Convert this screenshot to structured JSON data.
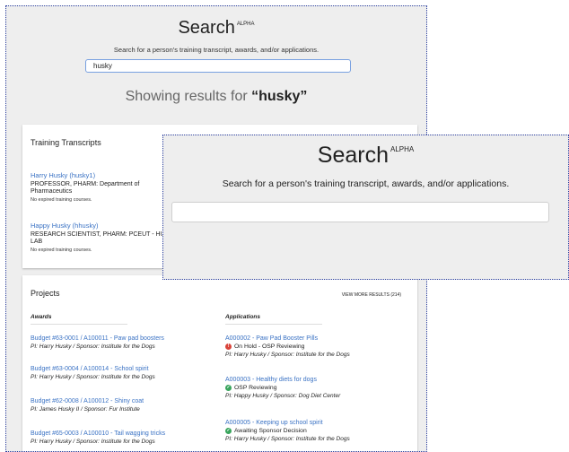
{
  "search": {
    "title": "Search",
    "badge": "ALPHA",
    "subtitle": "Search for a person's training transcript, awards, and/or applications.",
    "query": "husky",
    "showing_prefix": "Showing results for ",
    "showing_query": "“husky”"
  },
  "overlay": {
    "title": "Search",
    "badge": "ALPHA",
    "subtitle": "Search for a person's training transcript, awards, and/or applications.",
    "query": ""
  },
  "training": {
    "title": "Training Transcripts",
    "entries": [
      {
        "name": "Harry Husky (husky1)",
        "role": "PROFESSOR, PHARM: Department of Pharmaceutics",
        "note": "No expired training courses."
      },
      {
        "name": "Happy Husky (hhusky)",
        "role": "RESEARCH SCIENTIST, PHARM: PCEUT - HU LAB",
        "note": "No expired training courses."
      }
    ]
  },
  "projects": {
    "title": "Projects",
    "view_more": "VIEW MORE RESULTS (214)",
    "awards_header": "Awards",
    "applications_header": "Applications",
    "awards": [
      {
        "link": "Budget #63-0001 / A100011 - Paw pad boosters",
        "pi": "PI: Harry Husky / Sponsor: Institute for the Dogs"
      },
      {
        "link": "Budget #63-0004 / A100014 - School spirit",
        "pi": "PI: Harry Husky / Sponsor: Institute for the Dogs"
      },
      {
        "link": "Budget #62-0008 / A100012 - Shiny coat",
        "pi": "PI: James Husky II / Sponsor: Fur Institute"
      },
      {
        "link": "Budget #65-0003 / A100010 - Tail wagging tricks",
        "pi": "PI: Harry Husky / Sponsor: Institute for the Dogs"
      }
    ],
    "applications": [
      {
        "link": "A000002 - Paw Pad Booster Pills",
        "status": "On Hold - OSP Reviewing",
        "status_icon": "alert-icon",
        "status_color": "#d9443a",
        "pi": "PI: Harry Husky / Sponsor: Institute for the Dogs"
      },
      {
        "link": "A000003 - Healthy diets for dogs",
        "status": "OSP Reviewing",
        "status_icon": "check-icon",
        "status_color": "#3aa55d",
        "pi": "PI: Happy Husky / Sponsor: Dog Diet Center"
      },
      {
        "link": "A000005 - Keeping up school spirit",
        "status": "Awaiting Sponsor Decision",
        "status_icon": "check-icon",
        "status_color": "#3aa55d",
        "pi": "PI: Harry Husky / Sponsor: Institute for the Dogs"
      }
    ]
  }
}
